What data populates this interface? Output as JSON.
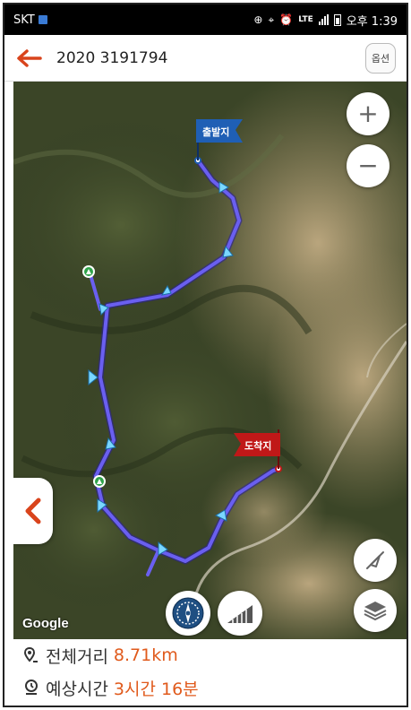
{
  "status_bar": {
    "carrier": "SKT",
    "network": "LTE",
    "time": "오후 1:39"
  },
  "header": {
    "title": "2020 3191794",
    "options_label": "옵션",
    "back_icon": "arrow-left-icon"
  },
  "map": {
    "start_label": "출발지",
    "end_label": "도착지",
    "attribution": "Google",
    "zoom_in_label": "+",
    "zoom_out_label": "−",
    "colors": {
      "route": "#5b4fd6",
      "start_flag": "#1f5fb5",
      "end_flag": "#c01818",
      "accent": "#e05a1c"
    }
  },
  "summary": {
    "distance_label": "전체거리",
    "distance_value": "8.71km",
    "time_label": "예상시간",
    "time_value": "3시간 16분"
  }
}
